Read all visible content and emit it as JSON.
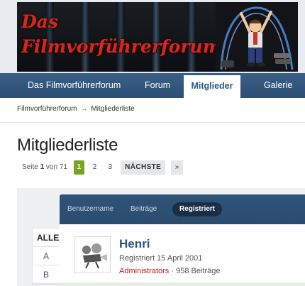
{
  "banner": {
    "title_line1": "Das",
    "title_line2": "Filmvorführerforum"
  },
  "nav": {
    "tabs": [
      {
        "label": "Das Filmvorführerforum"
      },
      {
        "label": "Forum"
      },
      {
        "label": "Mitglieder",
        "active": true
      },
      {
        "label": "Galerie"
      }
    ]
  },
  "breadcrumb": {
    "root": "Filmvorführerforum",
    "separator": "→",
    "current": "Mitgliederliste"
  },
  "page": {
    "title": "Mitgliederliste"
  },
  "pagination": {
    "prefix": "Seite",
    "current_page": "1",
    "of_text": "von 71",
    "pages": [
      "1",
      "2",
      "3"
    ],
    "next_label": "NÄCHSTE",
    "last_label": "»"
  },
  "sort": {
    "options": [
      {
        "label": "Benutzername"
      },
      {
        "label": "Beiträge"
      },
      {
        "label": "Registriert",
        "active": true
      }
    ]
  },
  "alpha_filter": {
    "items": [
      "ALLE",
      "A",
      "B"
    ]
  },
  "members": [
    {
      "name": "Henri",
      "joined": "Registriert 15 April 2001",
      "group": "Administrators",
      "separator": "·",
      "posts": "958 Beiträge"
    }
  ],
  "colors": {
    "nav_bg": "#2d4f73",
    "accent_green": "#7aa326",
    "group_red": "#c21c1c",
    "link_blue": "#2a5586"
  }
}
